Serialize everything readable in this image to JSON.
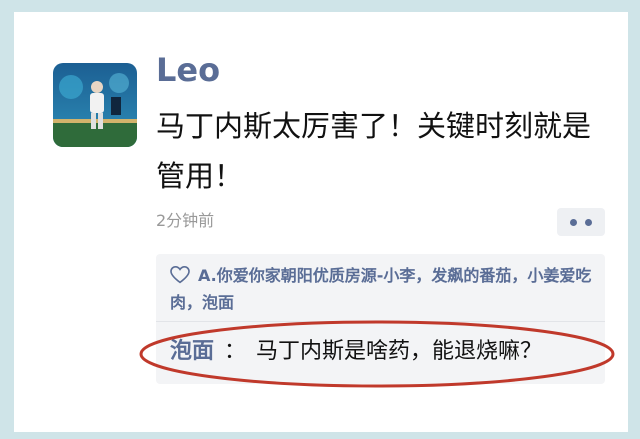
{
  "post": {
    "username": "Leo",
    "text": "马丁内斯太厉害了！关键时刻就是管用！",
    "timestamp": "2分钟前"
  },
  "icons": {
    "like": "heart-outline-icon",
    "more": "more-dots-icon"
  },
  "likes": {
    "names": "A.你爱你家朝阳优质房源-小李，发飙的番茄，小姜爱吃肉，泡面"
  },
  "comment": {
    "author": "泡面",
    "separator": "：",
    "text": "马丁内斯是啥药，能退烧嘛？"
  },
  "colors": {
    "link": "#5a6d96",
    "background": "#cfe4e8",
    "annotation": "#c0392b"
  }
}
